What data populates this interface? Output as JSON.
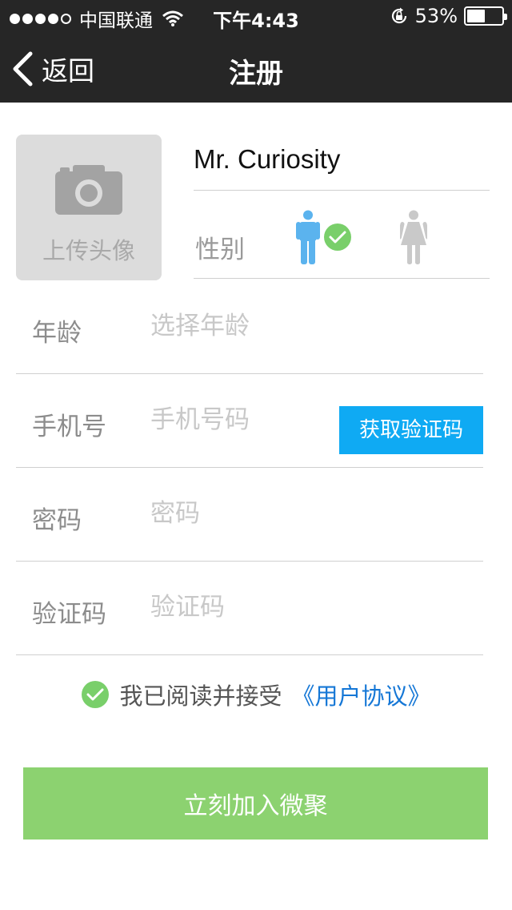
{
  "status_bar": {
    "carrier": "中国联通",
    "time": "下午4:43",
    "battery_percent": "53%",
    "battery_level": 0.53,
    "signal_bars_filled": 4,
    "signal_bars_total": 5
  },
  "nav": {
    "back_label": "返回",
    "title": "注册"
  },
  "profile": {
    "avatar_label": "上传头像",
    "name": "Mr. Curiosity",
    "gender_label": "性别",
    "gender_selected": "male",
    "male_color": "#5bb3ee",
    "female_color": "#c9c9c9",
    "check_color": "#79cf6a"
  },
  "form": {
    "age": {
      "label": "年龄",
      "placeholder": "选择年龄"
    },
    "phone": {
      "label": "手机号",
      "placeholder": "手机号码",
      "code_button": "获取验证码"
    },
    "password": {
      "label": "密码",
      "placeholder": "密码"
    },
    "verify": {
      "label": "验证码",
      "placeholder": "验证码"
    }
  },
  "agreement": {
    "text": "我已阅读并接受",
    "link": "《用户协议》",
    "checked": true
  },
  "submit_label": "立刻加入微聚",
  "colors": {
    "bar_bg": "#262626",
    "accent_blue": "#0faaf3",
    "link_blue": "#1577d6",
    "submit_green": "#8cd270"
  }
}
